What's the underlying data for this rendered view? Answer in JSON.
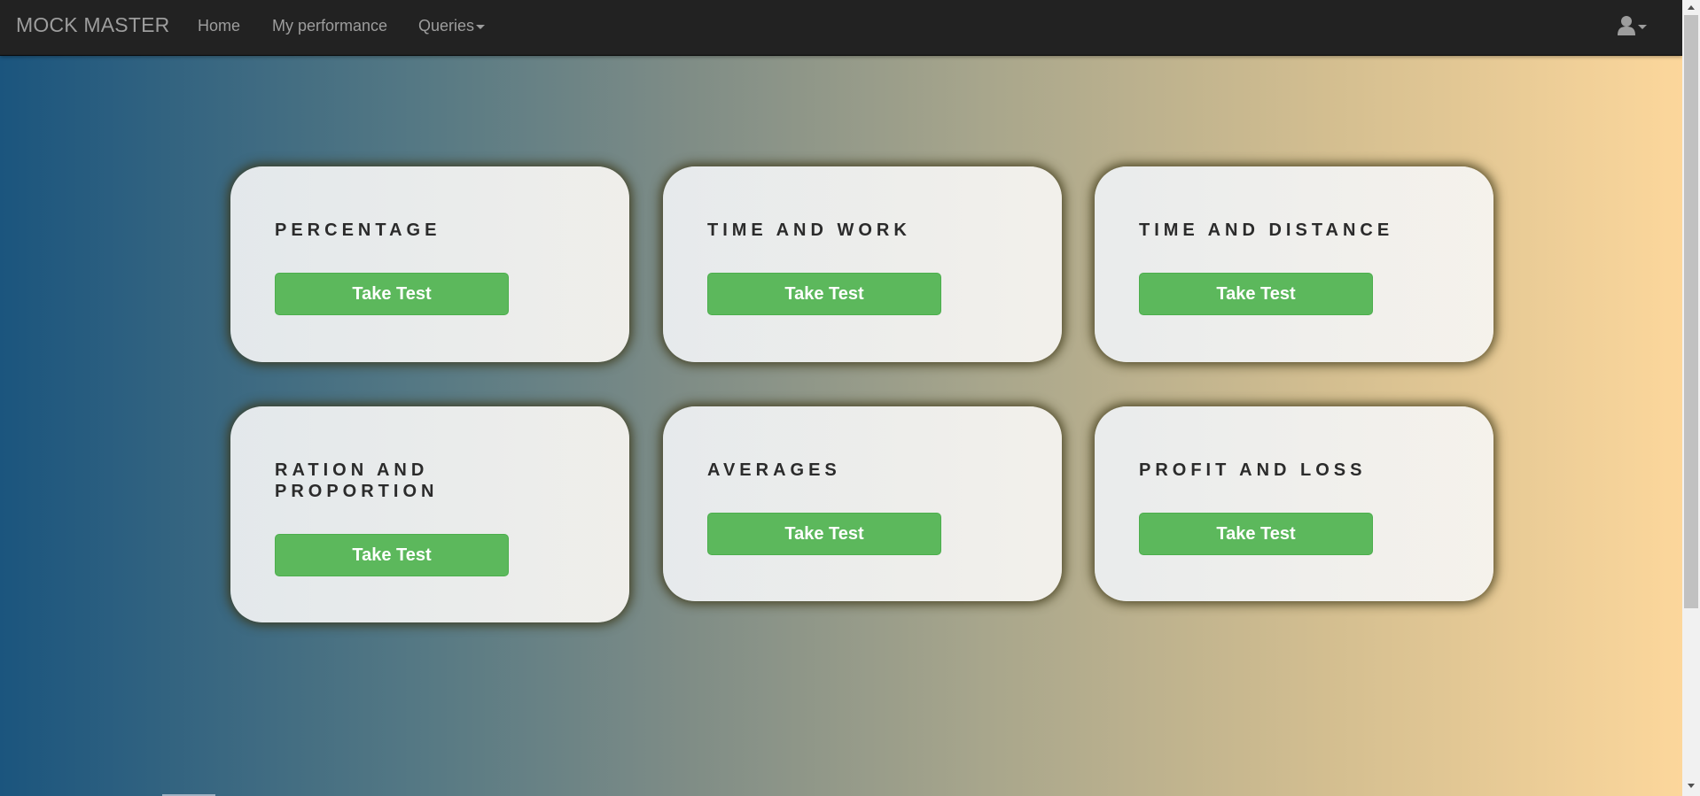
{
  "navbar": {
    "brand": "MOCK MASTER",
    "links": [
      "Home",
      "My performance",
      "Queries"
    ]
  },
  "topics": [
    {
      "title": "PERCENTAGE",
      "button": "Take Test"
    },
    {
      "title": "TIME AND WORK",
      "button": "Take Test"
    },
    {
      "title": "TIME AND DISTANCE",
      "button": "Take Test"
    },
    {
      "title": "RATION AND PROPORTION",
      "button": "Take Test"
    },
    {
      "title": "AVERAGES",
      "button": "Take Test"
    },
    {
      "title": "PROFIT AND LOSS",
      "button": "Take Test"
    }
  ],
  "colors": {
    "navbar_bg": "#222222",
    "nav_text": "#9d9d9d",
    "button_green": "#5cb85c",
    "gradient_left": "#1b557e",
    "gradient_right": "#fed89c"
  },
  "icons": [
    "user-icon",
    "caret-down-icon"
  ]
}
